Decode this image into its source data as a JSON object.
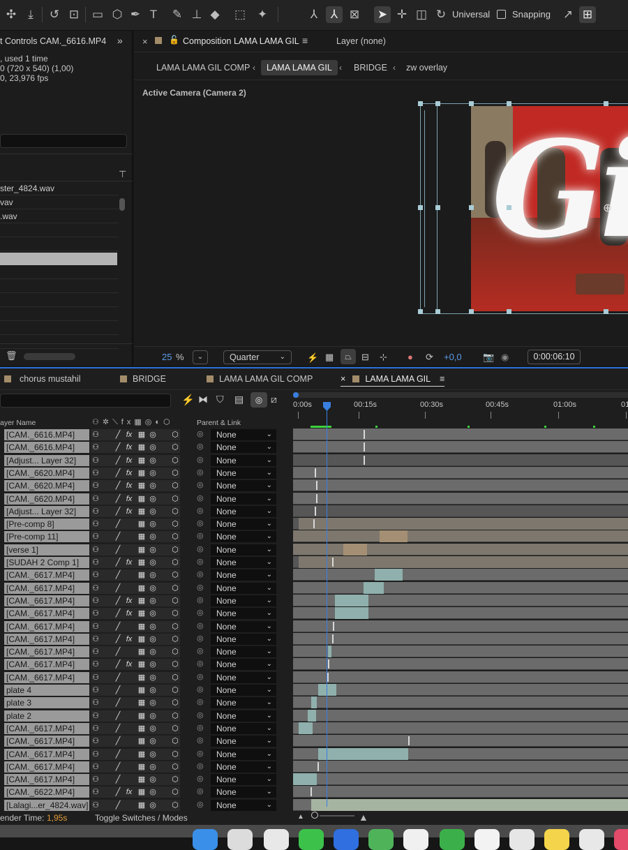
{
  "toolbar": {
    "universal_label": "Universal",
    "snapping_label": "Snapping"
  },
  "project": {
    "header": "t Controls CAM._6616.MP4",
    "used": ", used 1 time",
    "dims": "0  (720 x 540) (1,00)",
    "fps": "0, 23,976 fps",
    "items": [
      "ster_4824.wav",
      "vav",
      ".wav",
      "",
      "",
      "",
      "",
      "",
      "",
      "",
      "",
      ""
    ]
  },
  "viewer": {
    "tab_title": "Composition LAMA LAMA GIL",
    "layer_label": "Layer (none)",
    "breadcrumbs": [
      "LAMA LAMA GIL COMP",
      "LAMA LAMA GIL",
      "BRIDGE",
      "zw overlay"
    ],
    "camera_label": "Active Camera (Camera 2)",
    "graphic_text": "Gil",
    "zoom": "25",
    "zoom_unit": "%",
    "resolution": "Quarter",
    "exposure": "+0,0",
    "timecode": "0:00:06:10"
  },
  "timeline": {
    "tabs": [
      "chorus mustahil",
      "BRIDGE",
      "LAMA LAMA GIL COMP",
      "LAMA LAMA GIL"
    ],
    "ruler_labels": [
      "0:00s",
      "00:15s",
      "00:30s",
      "00:45s",
      "01:00s",
      "01"
    ],
    "col_layer_name": "ayer Name",
    "col_parent": "Parent & Link",
    "render_label": "ender Time:",
    "render_value": "1,95s",
    "toggle_label": "Toggle Switches / Modes",
    "layers": [
      {
        "name": "[CAM._6616.MP4]",
        "fx": true,
        "parent": "None"
      },
      {
        "name": "[CAM._6616.MP4]",
        "fx": true,
        "parent": "None"
      },
      {
        "name": "[Adjust... Layer 32]",
        "fx": true,
        "parent": "None"
      },
      {
        "name": "[CAM._6620.MP4]",
        "fx": true,
        "parent": "None"
      },
      {
        "name": "[CAM._6620.MP4]",
        "fx": true,
        "parent": "None"
      },
      {
        "name": "[CAM._6620.MP4]",
        "fx": true,
        "parent": "None"
      },
      {
        "name": "[Adjust... Layer 32]",
        "fx": true,
        "parent": "None"
      },
      {
        "name": "[Pre-comp 8]",
        "fx": false,
        "parent": "None"
      },
      {
        "name": "[Pre-comp 11]",
        "fx": false,
        "parent": "None"
      },
      {
        "name": "[verse 1]",
        "fx": false,
        "parent": "None"
      },
      {
        "name": "[SUDAH 2 Comp 1]",
        "fx": true,
        "parent": "None"
      },
      {
        "name": "[CAM._6617.MP4]",
        "fx": false,
        "parent": "None"
      },
      {
        "name": "[CAM._6617.MP4]",
        "fx": false,
        "parent": "None"
      },
      {
        "name": "[CAM._6617.MP4]",
        "fx": true,
        "parent": "None"
      },
      {
        "name": "[CAM._6617.MP4]",
        "fx": true,
        "parent": "None"
      },
      {
        "name": "[CAM._6617.MP4]",
        "fx": false,
        "parent": "None"
      },
      {
        "name": "[CAM._6617.MP4]",
        "fx": true,
        "parent": "None"
      },
      {
        "name": "[CAM._6617.MP4]",
        "fx": false,
        "parent": "None"
      },
      {
        "name": "[CAM._6617.MP4]",
        "fx": true,
        "parent": "None"
      },
      {
        "name": "[CAM._6617.MP4]",
        "fx": false,
        "parent": "None"
      },
      {
        "name": "plate 4",
        "fx": false,
        "parent": "None"
      },
      {
        "name": "plate 3",
        "fx": false,
        "parent": "None"
      },
      {
        "name": "plate 2",
        "fx": false,
        "parent": "None"
      },
      {
        "name": "[CAM._6617.MP4]",
        "fx": false,
        "parent": "None"
      },
      {
        "name": "[CAM._6617.MP4]",
        "fx": false,
        "parent": "None"
      },
      {
        "name": "[CAM._6617.MP4]",
        "fx": false,
        "parent": "None"
      },
      {
        "name": "[CAM._6617.MP4]",
        "fx": false,
        "parent": "None"
      },
      {
        "name": "[CAM._6617.MP4]",
        "fx": false,
        "parent": "None"
      },
      {
        "name": "[CAM._6622.MP4]",
        "fx": true,
        "parent": "None"
      },
      {
        "name": "[Lalagi...er_4824.wav]",
        "fx": false,
        "parent": "None"
      }
    ]
  }
}
